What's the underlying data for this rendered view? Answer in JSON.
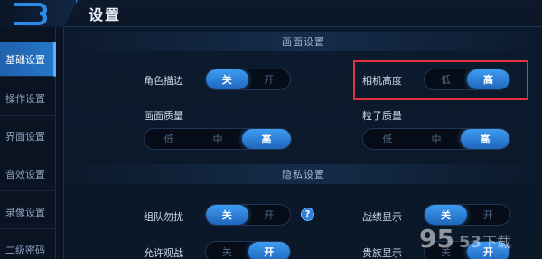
{
  "header": {
    "title": "设置"
  },
  "sidebar": {
    "items": [
      {
        "label": "基础设置",
        "active": true
      },
      {
        "label": "操作设置",
        "active": false
      },
      {
        "label": "界面设置",
        "active": false
      },
      {
        "label": "音效设置",
        "active": false
      },
      {
        "label": "录像设置",
        "active": false
      },
      {
        "label": "二级密码",
        "active": false
      }
    ]
  },
  "display_section": {
    "title": "画面设置",
    "outline": {
      "label": "角色描边",
      "options": [
        "关",
        "开"
      ],
      "selected": "关"
    },
    "camera_height": {
      "label": "相机高度",
      "options": [
        "低",
        "高"
      ],
      "selected": "高",
      "highlight_color": "#e0343a"
    },
    "quality": {
      "label": "画面质量",
      "options": [
        "低",
        "中",
        "高"
      ],
      "selected": "高"
    },
    "particle": {
      "label": "粒子质量",
      "options": [
        "低",
        "中",
        "高"
      ],
      "selected": "高"
    }
  },
  "privacy_section": {
    "title": "隐私设置",
    "team_dnd": {
      "label": "组队勿扰",
      "options": [
        "关",
        "开"
      ],
      "selected": "关",
      "help": "?"
    },
    "record_display": {
      "label": "战绩显示",
      "options": [
        "关",
        "开"
      ],
      "selected": "关"
    },
    "allow_spectate": {
      "label": "允许观战",
      "options": [
        "关",
        "开"
      ],
      "selected": "开"
    },
    "noble_display": {
      "label": "贵族显示",
      "options": [
        "关",
        "开"
      ],
      "selected": "开"
    }
  },
  "watermark": {
    "text": "9553下载"
  },
  "colors": {
    "accent": "#2577c8",
    "highlight": "#e0343a",
    "background": "#0a1424"
  }
}
